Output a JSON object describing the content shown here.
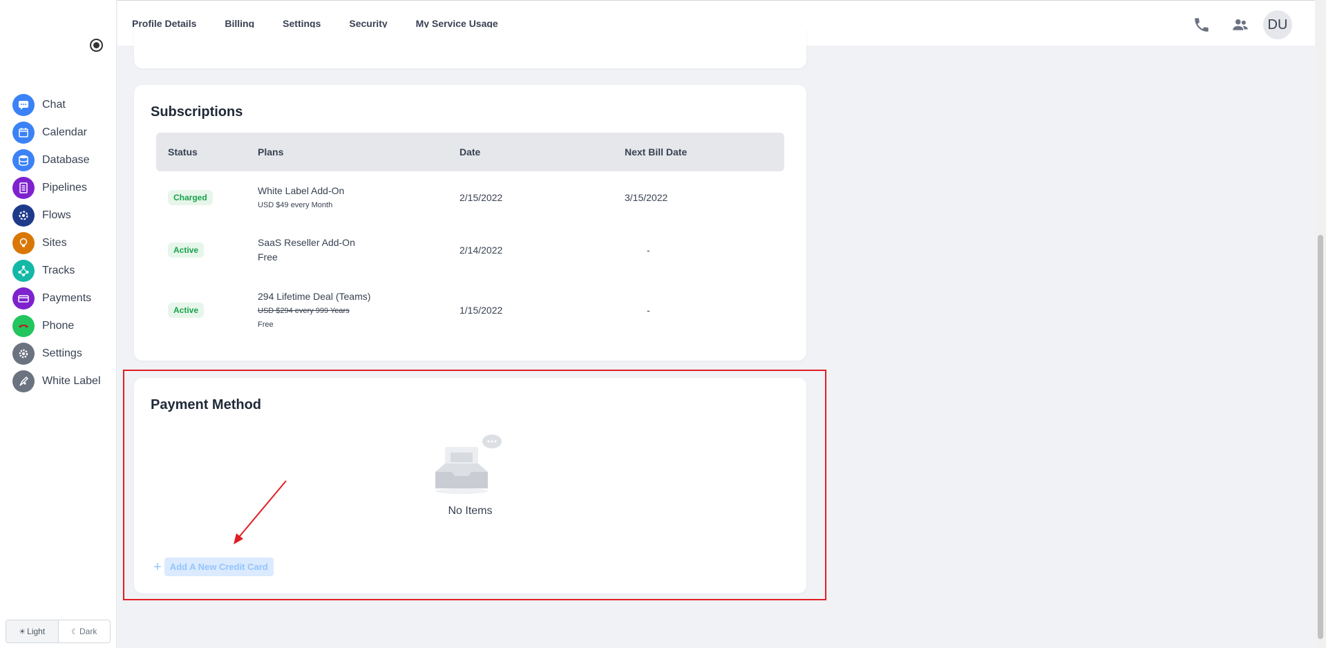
{
  "sidebar": {
    "items": [
      {
        "label": "Chat",
        "icon": "chat-icon",
        "color": "#3b82f6"
      },
      {
        "label": "Calendar",
        "icon": "calendar-icon",
        "color": "#3b82f6"
      },
      {
        "label": "Database",
        "icon": "database-icon",
        "color": "#3b82f6"
      },
      {
        "label": "Pipelines",
        "icon": "pipelines-icon",
        "color": "#7e22ce"
      },
      {
        "label": "Flows",
        "icon": "flows-icon",
        "color": "#1e40af"
      },
      {
        "label": "Sites",
        "icon": "sites-icon",
        "color": "#d97706"
      },
      {
        "label": "Tracks",
        "icon": "tracks-icon",
        "color": "#14b8a6"
      },
      {
        "label": "Payments",
        "icon": "payments-icon",
        "color": "#7e22ce"
      },
      {
        "label": "Phone",
        "icon": "phone-icon",
        "color": "#22c55e"
      },
      {
        "label": "Settings",
        "icon": "settings-icon",
        "color": "#6b7280"
      },
      {
        "label": "White Label",
        "icon": "white-label-icon",
        "color": "#6b7280"
      }
    ],
    "theme": {
      "light": "Light",
      "dark": "Dark"
    }
  },
  "tabs": [
    {
      "label": "Profile Details",
      "active": false
    },
    {
      "label": "Billing",
      "active": true
    },
    {
      "label": "Settings",
      "active": false
    },
    {
      "label": "Security",
      "active": false
    },
    {
      "label": "My Service Usage",
      "active": false
    }
  ],
  "user": {
    "initials": "DU"
  },
  "subscriptions": {
    "title": "Subscriptions",
    "headers": {
      "status": "Status",
      "plans": "Plans",
      "date": "Date",
      "next": "Next Bill Date"
    },
    "rows": [
      {
        "status": "Charged",
        "plan": "White Label Add-On",
        "sub": "USD $49 every Month",
        "date": "2/15/2022",
        "next": "3/15/2022"
      },
      {
        "status": "Active",
        "plan": "SaaS Reseller Add-On",
        "sub": "Free",
        "date": "2/14/2022",
        "next": "-"
      },
      {
        "status": "Active",
        "plan": "294 Lifetime Deal (Teams)",
        "strike": "USD $294 every 999 Years",
        "sub": "Free",
        "date": "1/15/2022",
        "next": "-"
      }
    ]
  },
  "payment": {
    "title": "Payment Method",
    "empty": "No Items",
    "add_label": "Add A New Credit Card"
  },
  "colors": {
    "accent": "#3b82f6",
    "highlight": "#e11d24",
    "badge_green": "#16a34a"
  }
}
